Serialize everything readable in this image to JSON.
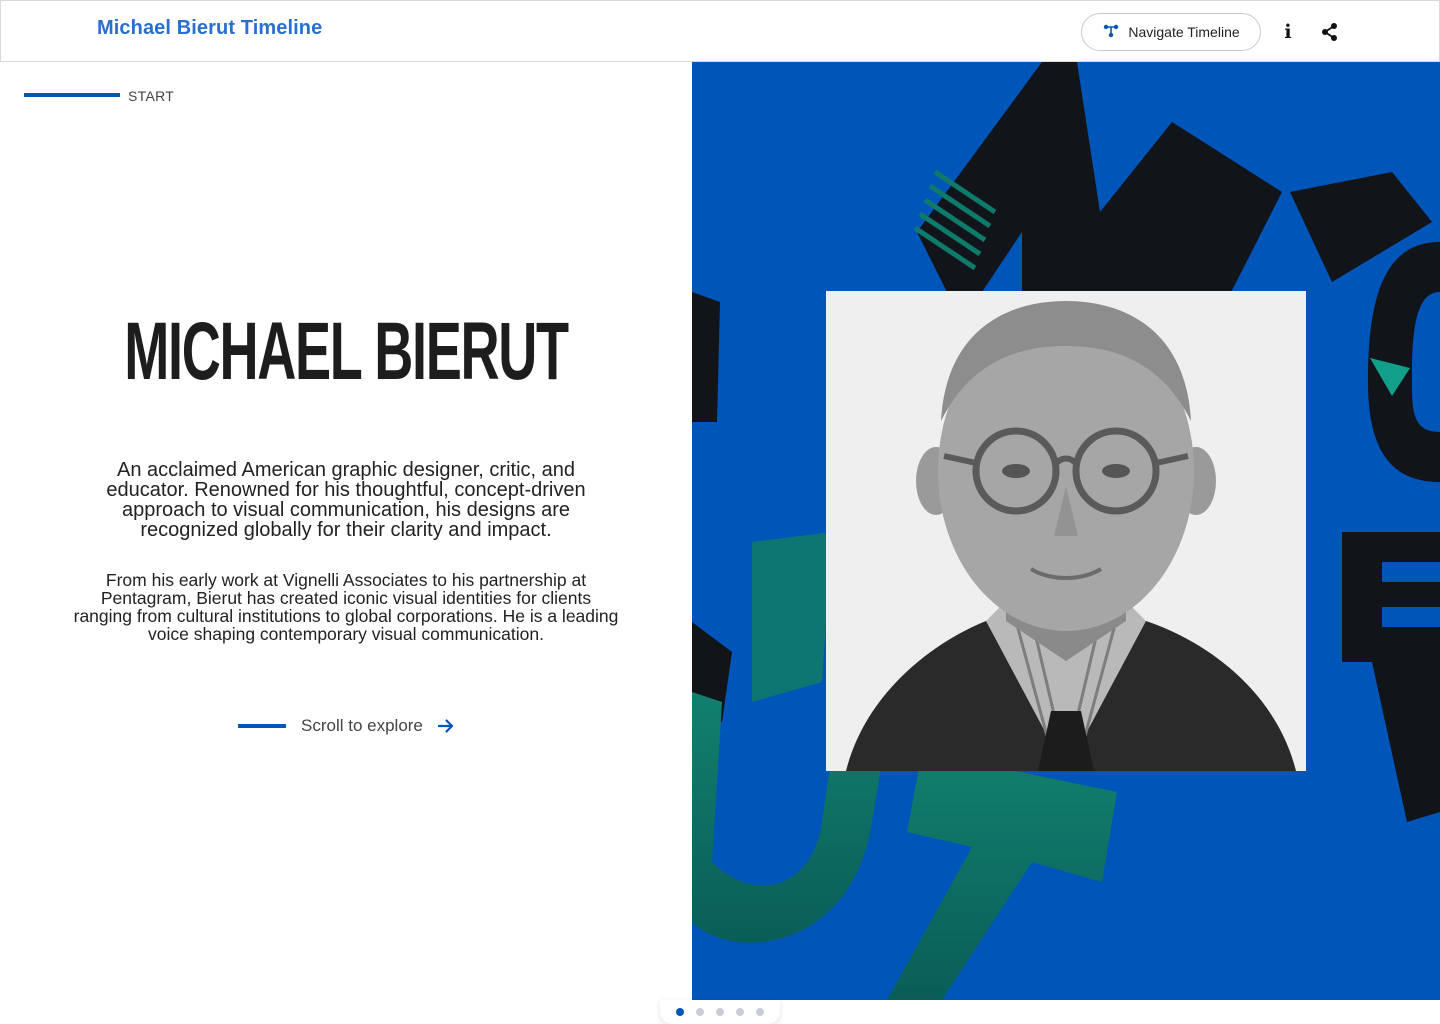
{
  "header": {
    "brand": "Michael Bierut Timeline",
    "navigate_label": "Navigate Timeline",
    "info_label": "i"
  },
  "hero": {
    "start_label": "START",
    "title": "MICHAEL BIERUT",
    "lead": "An acclaimed American graphic designer, critic, and educator. Renowned for his thoughtful, concept-driven approach to visual communication, his designs are recognized globally for their clarity and impact.",
    "body": "From his early work at Vignelli Associates to his partnership at Pentagram, Bierut has created iconic visual identities for clients ranging from cultural institutions to global corporations. He is a leading voice shaping contemporary visual communication.",
    "scroll_label": "Scroll to explore"
  },
  "pagination": {
    "count": 5,
    "active_index": 0
  },
  "colors": {
    "brand_blue": "#0055b8",
    "header_blue": "#2a6fd0",
    "teal": "#0f7a6a",
    "ink": "#111418"
  },
  "icons": {
    "navigate": "timeline-nodes-icon",
    "info": "info-icon",
    "share": "share-icon",
    "scroll": "arrow-right-icon"
  }
}
